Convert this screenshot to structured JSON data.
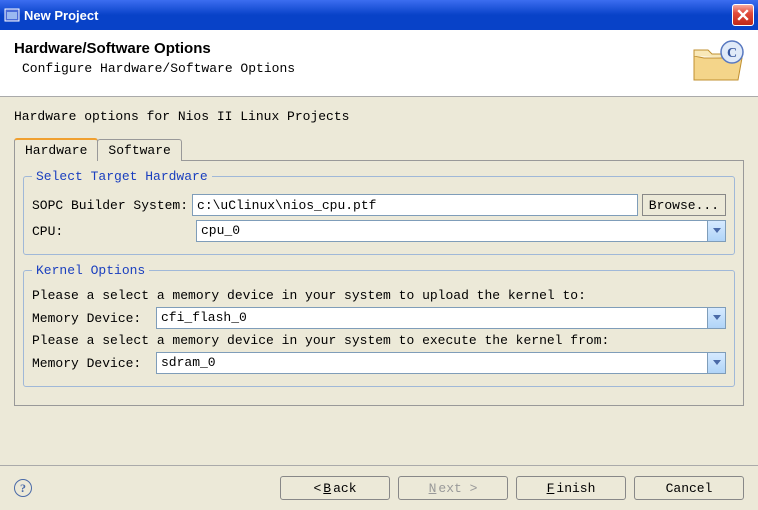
{
  "window": {
    "title": "New Project"
  },
  "header": {
    "title": "Hardware/Software Options",
    "subtitle": "Configure Hardware/Software Options"
  },
  "intro": "Hardware options for Nios II Linux Projects",
  "tabs": {
    "hardware": "Hardware",
    "software": "Software"
  },
  "target_hw": {
    "legend": "Select Target Hardware",
    "sopc_label": "SOPC Builder System:",
    "sopc_value": "c:\\uClinux\\nios_cpu.ptf",
    "browse_label": "Browse...",
    "cpu_label": "CPU:",
    "cpu_value": "cpu_0"
  },
  "kernel": {
    "legend": "Kernel Options",
    "upload_text": "Please a select a memory device in your system to upload the kernel to:",
    "mem_label": "Memory Device:",
    "upload_value": "cfi_flash_0",
    "exec_text": "Please a select a memory device in your system to execute the kernel from:",
    "exec_value": "sdram_0"
  },
  "footer": {
    "back_prefix": "< ",
    "back_ul": "B",
    "back_rest": "ack",
    "next_ul": "N",
    "next_rest": "ext >",
    "finish_ul": "F",
    "finish_rest": "inish",
    "cancel": "Cancel"
  }
}
